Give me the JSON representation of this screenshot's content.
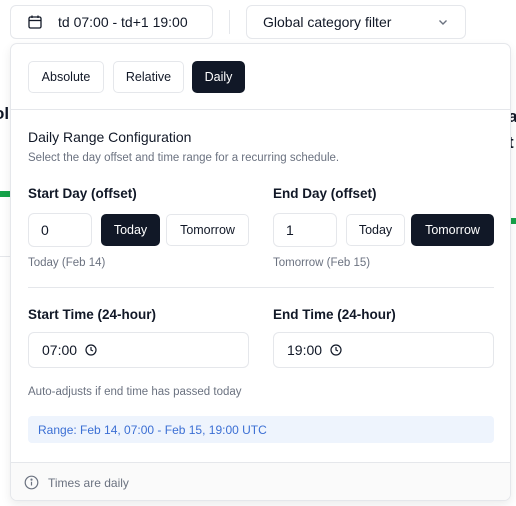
{
  "topbar": {
    "date_range": "td 07:00 - td+1 19:00",
    "category_filter": "Global category filter"
  },
  "background": {
    "left_fragment": "ol",
    "right_fragment_1": "a",
    "right_fragment_2": "t"
  },
  "modes": [
    {
      "label": "Absolute",
      "active": false
    },
    {
      "label": "Relative",
      "active": false
    },
    {
      "label": "Daily",
      "active": true
    }
  ],
  "daily": {
    "title": "Daily Range Configuration",
    "subtitle": "Select the day offset and time range for a recurring schedule.",
    "start_day": {
      "label": "Start Day (offset)",
      "value": "0",
      "today_label": "Today",
      "tomorrow_label": "Tomorrow",
      "selected": "Today",
      "hint": "Today (Feb 14)"
    },
    "end_day": {
      "label": "End Day (offset)",
      "value": "1",
      "today_label": "Today",
      "tomorrow_label": "Tomorrow",
      "selected": "Tomorrow",
      "hint": "Tomorrow (Feb 15)"
    },
    "start_time": {
      "label": "Start Time (24-hour)",
      "value": "07:00"
    },
    "end_time": {
      "label": "End Time (24-hour)",
      "value": "19:00"
    },
    "auto_adjust_note": "Auto-adjusts if end time has passed today",
    "range_summary": "Range: Feb 14, 07:00 - Feb 15, 19:00 UTC"
  },
  "footer": {
    "note": "Times are daily"
  },
  "colors": {
    "accent": "#111827",
    "border": "#e5e7eb",
    "muted_text": "#6b7280",
    "range_bg": "#eef4fd",
    "range_text": "#3b6fd4",
    "bg_green": "#16a34a"
  }
}
